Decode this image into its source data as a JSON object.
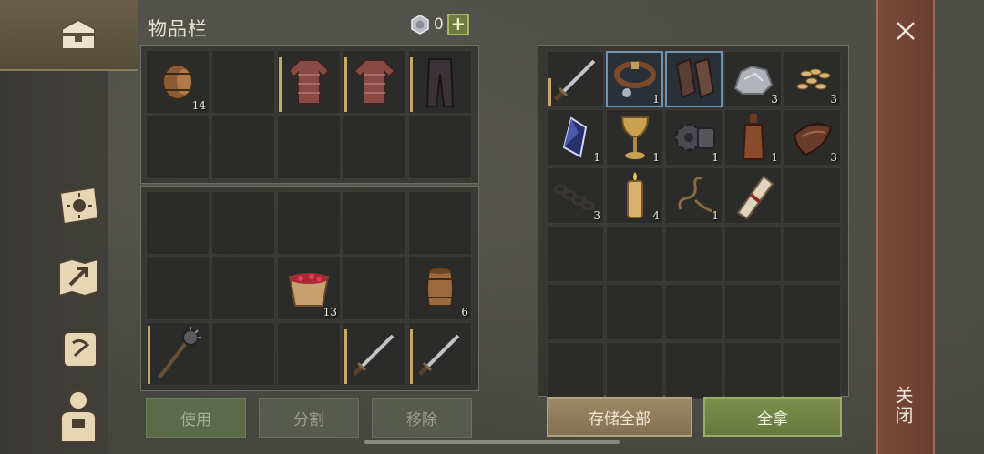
{
  "header": {
    "title": "物品栏",
    "currency_value": "0",
    "add_label": "+"
  },
  "sidebar": {
    "items": [
      {
        "name": "chest-icon"
      },
      {
        "name": "skills-book-icon"
      },
      {
        "name": "map-icon"
      },
      {
        "name": "quest-scroll-icon"
      },
      {
        "name": "character-icon"
      }
    ]
  },
  "equipment": {
    "slots": [
      {
        "item": "barrel",
        "count": "14"
      },
      {
        "item": "",
        "count": ""
      },
      {
        "item": "chainmail",
        "count": ""
      },
      {
        "item": "chainmail",
        "count": ""
      },
      {
        "item": "leather-pants",
        "count": ""
      },
      {
        "item": "",
        "count": ""
      },
      {
        "item": "",
        "count": ""
      },
      {
        "item": "",
        "count": ""
      },
      {
        "item": "",
        "count": ""
      },
      {
        "item": "",
        "count": ""
      }
    ]
  },
  "backpack": {
    "slots": [
      {
        "item": "",
        "count": ""
      },
      {
        "item": "",
        "count": ""
      },
      {
        "item": "",
        "count": ""
      },
      {
        "item": "",
        "count": ""
      },
      {
        "item": "",
        "count": ""
      },
      {
        "item": "",
        "count": ""
      },
      {
        "item": "",
        "count": ""
      },
      {
        "item": "berry-bucket",
        "count": "13"
      },
      {
        "item": "",
        "count": ""
      },
      {
        "item": "small-barrel",
        "count": "6"
      },
      {
        "item": "mace",
        "count": ""
      },
      {
        "item": "",
        "count": ""
      },
      {
        "item": "",
        "count": ""
      },
      {
        "item": "sword",
        "count": ""
      },
      {
        "item": "sword",
        "count": ""
      }
    ]
  },
  "loot": {
    "slots": [
      {
        "item": "sword",
        "count": ""
      },
      {
        "item": "collar",
        "count": "1"
      },
      {
        "item": "gauntlets",
        "count": ""
      },
      {
        "item": "stone",
        "count": "3"
      },
      {
        "item": "seeds",
        "count": "3"
      },
      {
        "item": "crystal",
        "count": "1"
      },
      {
        "item": "goblet",
        "count": "1"
      },
      {
        "item": "gear",
        "count": "1"
      },
      {
        "item": "bottle",
        "count": "1"
      },
      {
        "item": "leather",
        "count": "3"
      },
      {
        "item": "chain",
        "count": "3"
      },
      {
        "item": "candle",
        "count": "4"
      },
      {
        "item": "rope",
        "count": "1"
      },
      {
        "item": "scroll-roll",
        "count": ""
      },
      {
        "item": "",
        "count": ""
      }
    ]
  },
  "buttons": {
    "use": "使用",
    "split": "分割",
    "remove": "移除",
    "store_all": "存储全部",
    "take_all": "全拿"
  },
  "close": {
    "label": "关闭"
  }
}
